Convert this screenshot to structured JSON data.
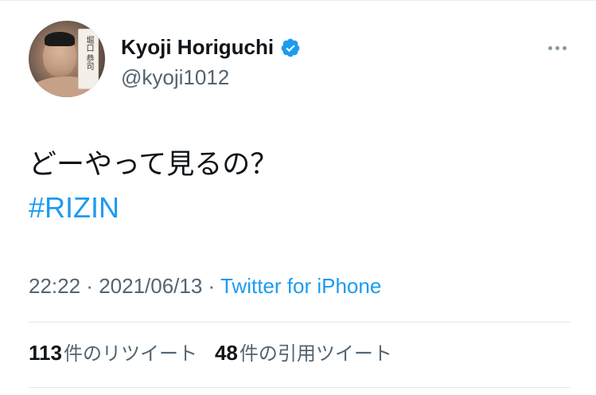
{
  "author": {
    "display_name": "Kyoji Horiguchi",
    "handle": "@kyoji1012",
    "verified": true,
    "avatar_card_text": "堀口 恭司"
  },
  "tweet": {
    "text": "どーやって見るの？",
    "hashtag": "#RIZIN"
  },
  "meta": {
    "time": "22:22",
    "separator": " · ",
    "date": "2021/06/13",
    "source": "Twitter for iPhone"
  },
  "stats": {
    "retweets_count": "113",
    "retweets_label": "件のリツイート",
    "quotes_count": "48",
    "quotes_label": "件の引用ツイート"
  },
  "colors": {
    "accent": "#1d9bf0",
    "secondary_text": "#536471",
    "primary_text": "#0f1419",
    "divider": "#e1e8ed"
  },
  "icons": {
    "verified": "verified-badge-icon",
    "more": "more-horizontal-icon"
  }
}
